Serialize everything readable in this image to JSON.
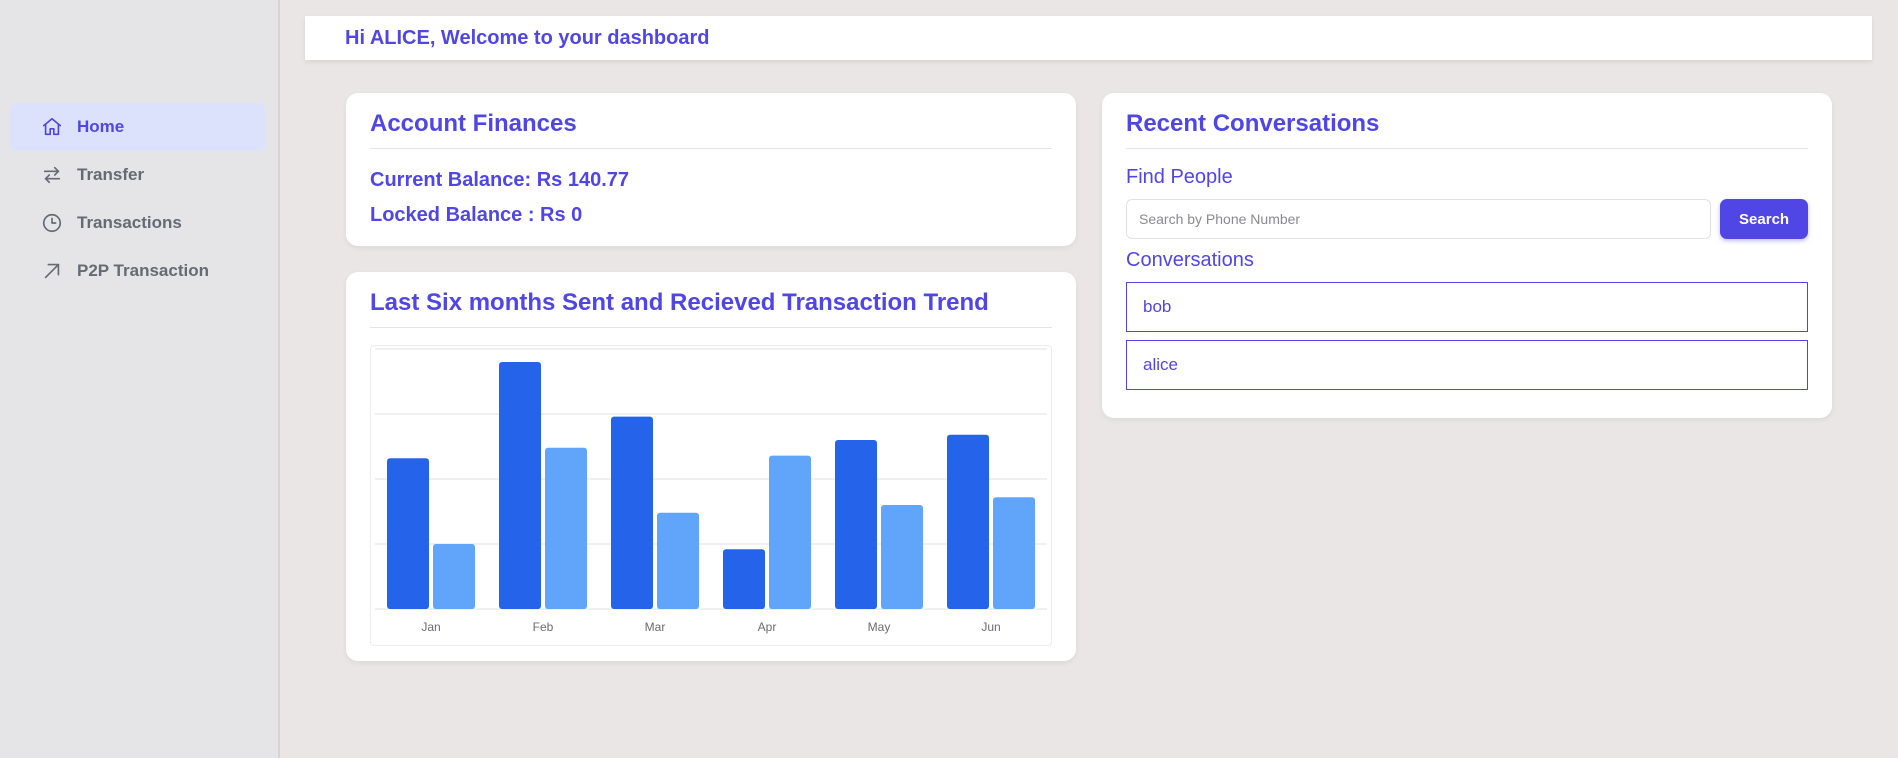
{
  "header": {
    "greeting": "Hi ALICE, Welcome to your dashboard"
  },
  "sidebar": {
    "items": [
      {
        "label": "Home",
        "icon": "home-icon",
        "active": true
      },
      {
        "label": "Transfer",
        "icon": "transfer-icon",
        "active": false
      },
      {
        "label": "Transactions",
        "icon": "clock-icon",
        "active": false
      },
      {
        "label": "P2P Transaction",
        "icon": "arrow-up-right-icon",
        "active": false
      }
    ]
  },
  "finances": {
    "title": "Account Finances",
    "current_balance": "Current Balance: Rs 140.77",
    "locked_balance": "Locked Balance : Rs 0"
  },
  "trend": {
    "title": "Last Six months Sent and Recieved Transaction Trend"
  },
  "conversations": {
    "title": "Recent Conversations",
    "find_people": "Find People",
    "search_placeholder": "Search by Phone Number",
    "search_button": "Search",
    "conversations_label": "Conversations",
    "items": [
      "bob",
      "alice"
    ]
  },
  "colors": {
    "accent": "#4f46e5",
    "series_dark": "#2563eb",
    "series_light": "#60a5fa"
  },
  "chart_data": {
    "type": "bar",
    "categories": [
      "Jan",
      "Feb",
      "Mar",
      "Apr",
      "May",
      "Jun"
    ],
    "series": [
      {
        "values": [
          58,
          95,
          74,
          23,
          65,
          67
        ]
      },
      {
        "values": [
          25,
          62,
          37,
          59,
          40,
          43
        ]
      }
    ],
    "ylim": [
      0,
      100
    ],
    "grid": true,
    "legend": "none"
  }
}
